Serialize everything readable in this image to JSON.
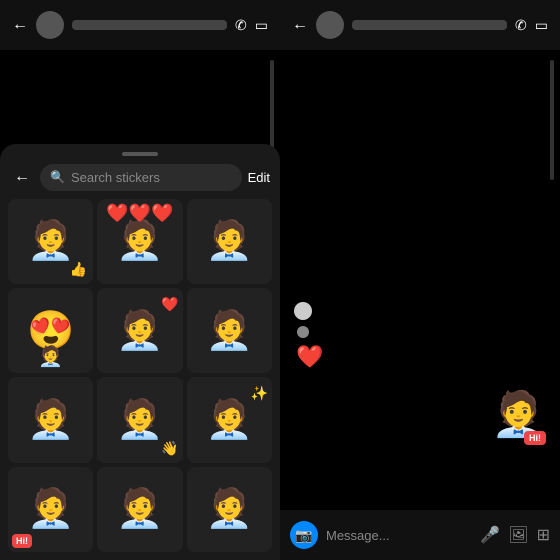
{
  "left": {
    "topBar": {
      "backLabel": "←",
      "phoneIcon": "✆",
      "videoIcon": "▭"
    },
    "stickerPanel": {
      "searchPlaceholder": "Search stickers",
      "editLabel": "Edit",
      "backLabel": "←",
      "stickers": [
        {
          "id": 1,
          "emoji": "🧑‍💼",
          "extra": "thumbsup",
          "badge": null
        },
        {
          "id": 2,
          "emoji": "🧑‍💼",
          "extra": "hearts",
          "badge": null
        },
        {
          "id": 3,
          "emoji": "🧑‍💼",
          "extra": "plain",
          "badge": null
        },
        {
          "id": 4,
          "emoji": "🧑‍💼",
          "extra": "hearteyes",
          "badge": null
        },
        {
          "id": 5,
          "emoji": "🧑‍💼",
          "extra": "heartside",
          "badge": null
        },
        {
          "id": 6,
          "emoji": "🧑‍💼",
          "extra": "plain2",
          "badge": null
        },
        {
          "id": 7,
          "emoji": "🧑‍💼",
          "extra": "plain3",
          "badge": null
        },
        {
          "id": 8,
          "emoji": "🧑‍💼",
          "extra": "wave",
          "badge": null
        },
        {
          "id": 9,
          "emoji": "🧑‍💼",
          "extra": "sparkle",
          "badge": null
        },
        {
          "id": 10,
          "emoji": "🧑‍💼",
          "extra": "hibadge",
          "badge": "Hi!"
        },
        {
          "id": 11,
          "emoji": "🧑‍💼",
          "extra": "plain4",
          "badge": null
        },
        {
          "id": 12,
          "emoji": "🧑‍💼",
          "extra": "plain5",
          "badge": null
        }
      ]
    }
  },
  "right": {
    "topBar": {
      "backLabel": "←",
      "phoneIcon": "✆",
      "videoIcon": "▭"
    },
    "messageBar": {
      "placeholder": "Message...",
      "micIcon": "🎤",
      "imageIcon": "🖼",
      "gifIcon": "⊞"
    },
    "stickerHiBadge": "Hi!",
    "heartReaction": "❤️"
  }
}
